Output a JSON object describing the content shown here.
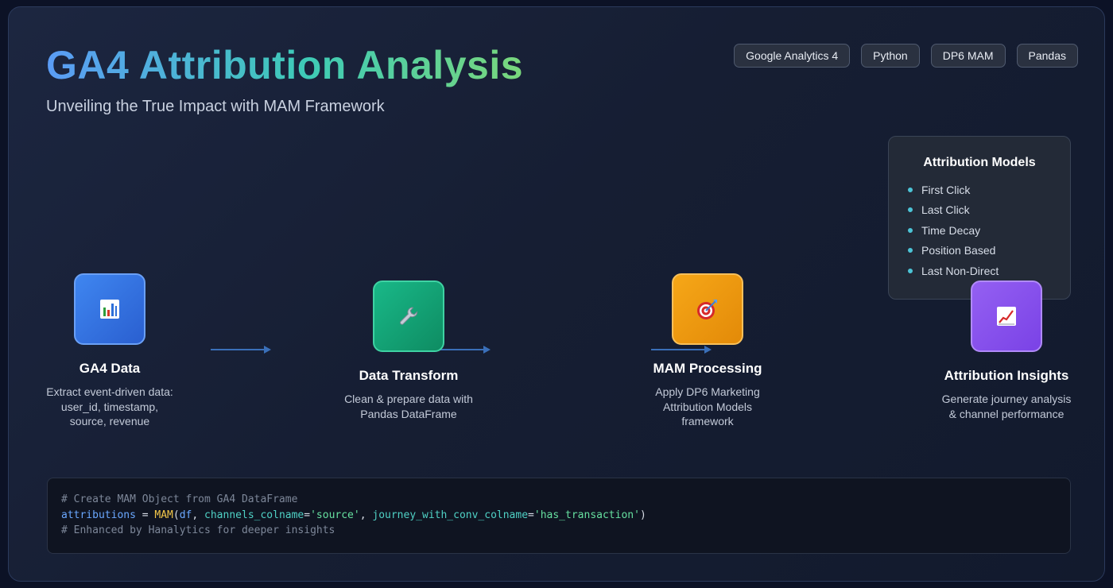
{
  "title": "GA4 Attribution Analysis",
  "subtitle": "Unveiling the True Impact with MAM Framework",
  "tags": [
    "Google Analytics 4",
    "Python",
    "DP6 MAM",
    "Pandas"
  ],
  "attribution_models": {
    "title": "Attribution Models",
    "items": [
      "First Click",
      "Last Click",
      "Time Decay",
      "Position Based",
      "Last Non-Direct"
    ]
  },
  "steps": [
    {
      "title": "GA4 Data",
      "description": "Extract event-driven data: user_id, timestamp, source, revenue",
      "icon": "bar-chart-icon",
      "color": "#3b7ae6"
    },
    {
      "title": "Data Transform",
      "description": "Clean & prepare data with Pandas DataFrame",
      "icon": "wrench-icon",
      "color": "#14a878"
    },
    {
      "title": "MAM Processing",
      "description": "Apply DP6 Marketing Attribution Models framework",
      "icon": "target-icon",
      "color": "#f29a12"
    },
    {
      "title": "Attribution Insights",
      "description": "Generate journey analysis & channel performance",
      "icon": "trend-chart-icon",
      "color": "#8a52ee"
    }
  ],
  "code": {
    "line1_comment": "# Create MAM Object from GA4 DataFrame",
    "line2": {
      "var": "attributions",
      "op": " = ",
      "fn": "MAM",
      "open": "(",
      "arg1": "df",
      "sep1": ", ",
      "kw1": "channels_colname",
      "eq1": "=",
      "str1": "'source'",
      "sep2": ", ",
      "kw2": "journey_with_conv_colname",
      "eq2": "=",
      "str2": "'has_transaction'",
      "close": ")"
    },
    "line3_comment": "# Enhanced by Hanalytics for deeper insights"
  }
}
